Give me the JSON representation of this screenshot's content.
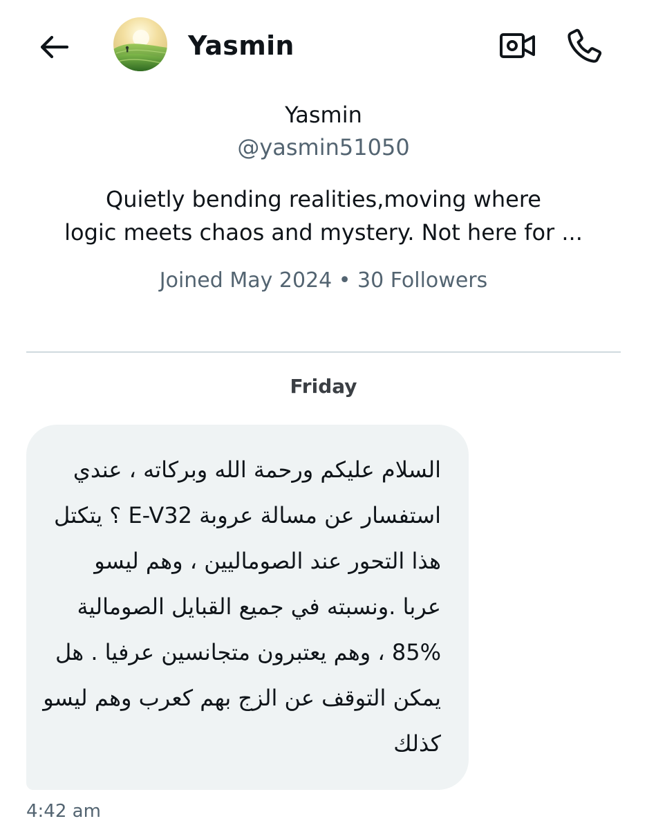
{
  "header": {
    "title": "Yasmin",
    "back_icon": "arrow-left-icon",
    "video_icon": "video-call-icon",
    "phone_icon": "phone-icon"
  },
  "profile": {
    "name": "Yasmin",
    "handle": "@yasmin51050",
    "bio_line1": "Quietly bending realities,moving where",
    "bio_line2": "logic meets chaos and mystery. Not here for ...",
    "meta": "Joined May 2024 • 30 Followers"
  },
  "conversation": {
    "day_label": "Friday",
    "messages": [
      {
        "lines": [
          "السلام عليكم ورحمة الله وبركاته ، عندي",
          "استفسار عن مسالة عروبة E-V32 ؟ يتكتل",
          "هذا التحور عند الصوماليين ، وهم ليسو",
          "عربا .ونسبته في جميع القبايل الصومالية",
          "85% ، وهم يعتبرون متجانسين عرفيا . هل",
          "يمكن التوقف عن الزج بهم كعرب وهم ليسو",
          "كذلك"
        ],
        "time": "4:42 am"
      }
    ]
  },
  "colors": {
    "text_primary": "#0f1419",
    "text_secondary": "#536471",
    "bubble_bg": "#eff3f4",
    "divider": "#cfd9de"
  }
}
